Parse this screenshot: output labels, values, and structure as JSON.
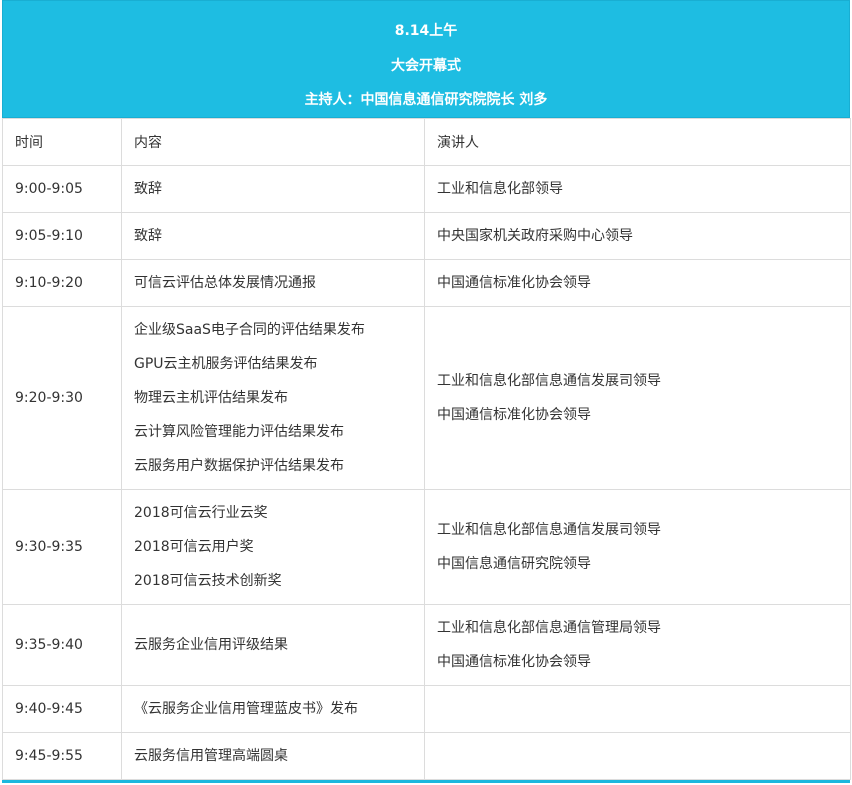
{
  "header": {
    "date": "8.14上午",
    "session": "大会开幕式",
    "host": "主持人：中国信息通信研究院院长 刘多"
  },
  "columns": {
    "time": "时间",
    "content": "内容",
    "speaker": "演讲人"
  },
  "rows": [
    {
      "time": "9:00-9:05",
      "content": [
        "致辞"
      ],
      "speaker": [
        "工业和信息化部领导"
      ]
    },
    {
      "time": "9:05-9:10",
      "content": [
        "致辞"
      ],
      "speaker": [
        "中央国家机关政府采购中心领导"
      ]
    },
    {
      "time": "9:10-9:20",
      "content": [
        "可信云评估总体发展情况通报"
      ],
      "speaker": [
        "中国通信标准化协会领导"
      ]
    },
    {
      "time": "9:20-9:30",
      "content": [
        "企业级SaaS电子合同的评估结果发布",
        "GPU云主机服务评估结果发布",
        "物理云主机评估结果发布",
        "云计算风险管理能力评估结果发布",
        "云服务用户数据保护评估结果发布"
      ],
      "speaker": [
        "工业和信息化部信息通信发展司领导",
        "中国通信标准化协会领导"
      ]
    },
    {
      "time": "9:30-9:35",
      "content": [
        "2018可信云行业云奖",
        "2018可信云用户奖",
        "2018可信云技术创新奖"
      ],
      "speaker": [
        "工业和信息化部信息通信发展司领导",
        "中国信息通信研究院领导"
      ]
    },
    {
      "time": "9:35-9:40",
      "content": [
        "云服务企业信用评级结果"
      ],
      "speaker": [
        "工业和信息化部信息通信管理局领导",
        "中国通信标准化协会领导"
      ]
    },
    {
      "time": "9:40-9:45",
      "content": [
        "《云服务企业信用管理蓝皮书》发布"
      ],
      "speaker": [
        ""
      ]
    },
    {
      "time": "9:45-9:55",
      "content": [
        "云服务信用管理高端圆桌"
      ],
      "speaker": [
        ""
      ]
    }
  ]
}
